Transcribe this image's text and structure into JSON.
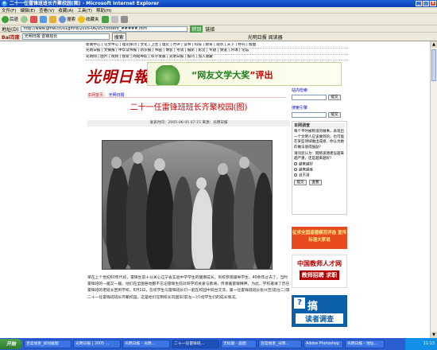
{
  "window": {
    "title": "二十一任雷锋班班长齐聚校园(图) - Microsoft Internet Explorer"
  },
  "menu": [
    "文件(F)",
    "编辑(E)",
    "查看(V)",
    "收藏(A)",
    "工具(T)",
    "帮助(H)"
  ],
  "toolbar": {
    "back": "后退",
    "search": "搜索",
    "favorites": "收藏夹"
  },
  "address": {
    "label": "地址(D)",
    "url": "http://www.gmw.cn/01gmrb/2005-06/05/content_#####.htm",
    "go": "转到",
    "links": "链接"
  },
  "searchbar": {
    "brand": "Bai百度",
    "query": "光明日报 雷锋班长",
    "search_btn": "搜索",
    "extra": "光明日报 阅读器"
  },
  "page": {
    "nav_rows": [
      "新闻中心 | 论文中心 | 理论探讨 | 文化 | 卫生 | 理论 | 时评 | 读书 | 科技 | 教育 | 观点 | 天下 | 特刊 | 版面",
      "光明日报 | 文摘报 | 中华读书报 | 新京报 | 书画 | 博客 | 考试 | 摄影 | 影音 | 专题 | 频道 | 环球 | 论坛",
      "光明网 | 图片 | 视频 | 搜索 | 网站导航 | 科学发展 | 光明日报 | 报刊 | 加入收藏"
    ],
    "logo": "光明日報",
    "banner_prefix": "“",
    "banner_highlight": "网友文学大奖",
    "banner_suffix": "”评出",
    "breadcrumb_label": "本网首页：",
    "breadcrumb_link": "光明日报",
    "headline": "二十一任雷锋班班长齐聚校园(图)",
    "meta": "发表时间：2005-06-05 07:15   来源：光明日报",
    "body_text": "早在上个世纪60年代初，雷锋生前十分关心辽宁省实验中学学生的健康成长。到校参观辅导学生，40余年过去了，当时雷锋班的一届又一届，他们在全国各地都不忘记雷锋生前对同学的关爱与教诲，传承着雷锋精神。为此，学校邀请了历任雷锋班的老班长回到学校。6月1日，在校学生与雷锋班长们一起在校园中同台交流，第一任雷锋班班长张兴吉(前左二)等二十一任雷锋班班长齐聚校园，这是他们在明校长刘国华(前左一)介绍学生们的成长情况。"
  },
  "sidebar": {
    "search1_title": "站内检索",
    "search1_btn": "提交",
    "search2_title": "搜索引擎",
    "search2_btn": "提交",
    "survey_title": "本网调查",
    "survey_text": "每个平时被称道的做事，表现出一个文明人应该做到的，也可能在某些领域做出成绩、你认为她的做法值得鼓励？",
    "survey_question": "请问您认为：网络道德建设越来越严重，还是越来越好？",
    "options": [
      "越来越好",
      "越来越差",
      "说不清"
    ],
    "submit": "提交",
    "view": "查看",
    "ad1": "征求全国道德模范评选 宣传标语大家说",
    "ad2_line1": "中国教师人才网",
    "ad2_line2": "教师招聘 求职",
    "ad3_big": "搞",
    "ad3_small": "读者调查",
    "ad3_q": "?"
  },
  "taskbar": {
    "start": "开始",
    "tasks": [
      "百度搜索_如何截图",
      "光明日报 | 2005 ...",
      "光明日报 - 光明...",
      "二十一任雷锋班...",
      "无标题 - 画图",
      "百度搜索_光明...",
      "Adobe Photoshop",
      "光明日报 - 地址..."
    ],
    "time": "11:13"
  },
  "colors": {
    "titlebar": "#0a3fb8",
    "headline": "#cc0000",
    "link": "#0000cc",
    "taskbar": "#2b5fd0"
  }
}
